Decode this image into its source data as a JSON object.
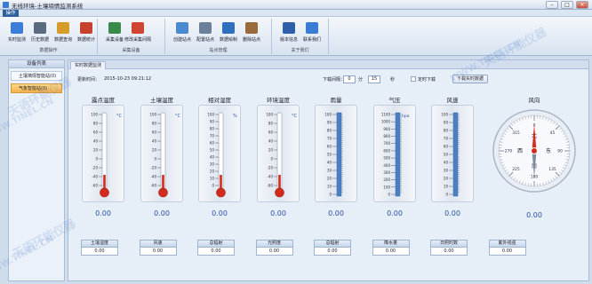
{
  "window": {
    "title": "无线环境-土壤墒情监测系统"
  },
  "menu": {
    "tab": "操作"
  },
  "ribbon": {
    "groups": [
      {
        "title": "数据操作",
        "buttons": [
          {
            "label": "实时监测",
            "icon": "monitor-icon",
            "color": "#3b7dd8"
          },
          {
            "label": "历史数据",
            "icon": "printer-icon",
            "color": "#5a6b80"
          },
          {
            "label": "数据查询",
            "icon": "query-icon",
            "color": "#d79b2a"
          },
          {
            "label": "数据统计",
            "icon": "statistics-icon",
            "color": "#c8412f"
          }
        ]
      },
      {
        "title": "采集设备",
        "buttons": [
          {
            "label": "采集设备",
            "icon": "device-icon",
            "color": "#3a8a4a"
          },
          {
            "label": "修改采集间隔",
            "icon": "refresh-icon",
            "color": "#d0452f"
          }
        ]
      },
      {
        "title": "站点管理",
        "buttons": [
          {
            "label": "创建站点",
            "icon": "create-site-icon",
            "color": "#4a8ad0"
          },
          {
            "label": "配置站点",
            "icon": "config-site-icon",
            "color": "#6b7f99"
          },
          {
            "label": "数据绘制",
            "icon": "chart-icon",
            "color": "#2f6fbe"
          },
          {
            "label": "删除站点",
            "icon": "delete-site-icon",
            "color": "#9a6b3a"
          }
        ]
      },
      {
        "title": "关于我们",
        "buttons": [
          {
            "label": "版本信息",
            "icon": "version-icon",
            "color": "#2f5fa8"
          },
          {
            "label": "联系我们",
            "icon": "contact-icon",
            "color": "#3a7bd5"
          }
        ]
      }
    ]
  },
  "sidebar": {
    "title": "设备列表",
    "items": [
      {
        "label": "土壤墒情智能站(0)",
        "active": false
      },
      {
        "label": "气象智能站(0)",
        "active": true
      }
    ]
  },
  "content": {
    "tab": "实时数据监测",
    "updated_label": "更新时间：",
    "updated_value": "2015-10-23 09:21:12",
    "interval_label": "下载间隔：",
    "interval_min": "0",
    "min_unit": "分",
    "interval_sec": "15",
    "sec_unit": "秒",
    "auto_label": "定时下载",
    "download_button": "下载实时数据"
  },
  "gauges": [
    {
      "label": "露点温度",
      "type": "thermo",
      "unit": "°C",
      "ticks": [
        "100",
        "80",
        "60",
        "40",
        "20",
        "0",
        "-20",
        "-40",
        "-60"
      ],
      "value": "0.00"
    },
    {
      "label": "土壤温度",
      "type": "thermo",
      "unit": "°C",
      "ticks": [
        "100",
        "80",
        "60",
        "40",
        "20",
        "0",
        "-20",
        "-40",
        "-60"
      ],
      "value": "0.00"
    },
    {
      "label": "相对湿度",
      "type": "thermo",
      "unit": "%",
      "ticks": [
        "100",
        "90",
        "80",
        "70",
        "60",
        "50",
        "40",
        "30",
        "20",
        "10",
        "0"
      ],
      "value": "0.00"
    },
    {
      "label": "环境温度",
      "type": "thermo",
      "unit": "°C",
      "ticks": [
        "100",
        "80",
        "60",
        "40",
        "20",
        "0",
        "-20",
        "-40",
        "-60"
      ],
      "value": "0.00"
    },
    {
      "label": "雨量",
      "type": "bar",
      "unit": "",
      "ticks": [
        "100",
        "90",
        "80",
        "70",
        "60",
        "50",
        "40",
        "30",
        "20",
        "10",
        "0"
      ],
      "value": "0.00"
    },
    {
      "label": "气压",
      "type": "bar",
      "unit": "hpa",
      "ticks": [
        "1100",
        "1000",
        "900",
        "800",
        "700",
        "600",
        "500",
        "400",
        "300",
        "200",
        "100",
        "0"
      ],
      "value": "0.00"
    },
    {
      "label": "风速",
      "type": "bar",
      "unit": "",
      "ticks": [
        "100",
        "90",
        "80",
        "70",
        "60",
        "50",
        "40",
        "30",
        "20",
        "10",
        "0"
      ],
      "value": "0.00"
    }
  ],
  "compass": {
    "label": "风向",
    "value": "0.00",
    "dirs": {
      "n": "北",
      "e": "东",
      "s": "南",
      "w": "西"
    },
    "ticks": [
      "0",
      "45",
      "90",
      "135",
      "180",
      "225",
      "270",
      "315"
    ]
  },
  "stats": [
    {
      "label": "土壤湿度",
      "value": "0.00"
    },
    {
      "label": "风速",
      "value": "0.00"
    },
    {
      "label": "总辐射",
      "value": "0.00"
    },
    {
      "label": "光照度",
      "value": "0.00"
    },
    {
      "label": "总辐射",
      "value": "0.00"
    },
    {
      "label": "降水量",
      "value": "0.00"
    },
    {
      "label": "日照时数",
      "value": "0.00"
    },
    {
      "label": "紫外线强",
      "value": "0.00"
    }
  ],
  "watermarks": [
    "天语环能仪器",
    "WWW.TINEL.CN",
    "天语环能仪器",
    "WWW.TINEL.CN",
    "天语环能仪器",
    "WWW.TINEL.CN"
  ]
}
